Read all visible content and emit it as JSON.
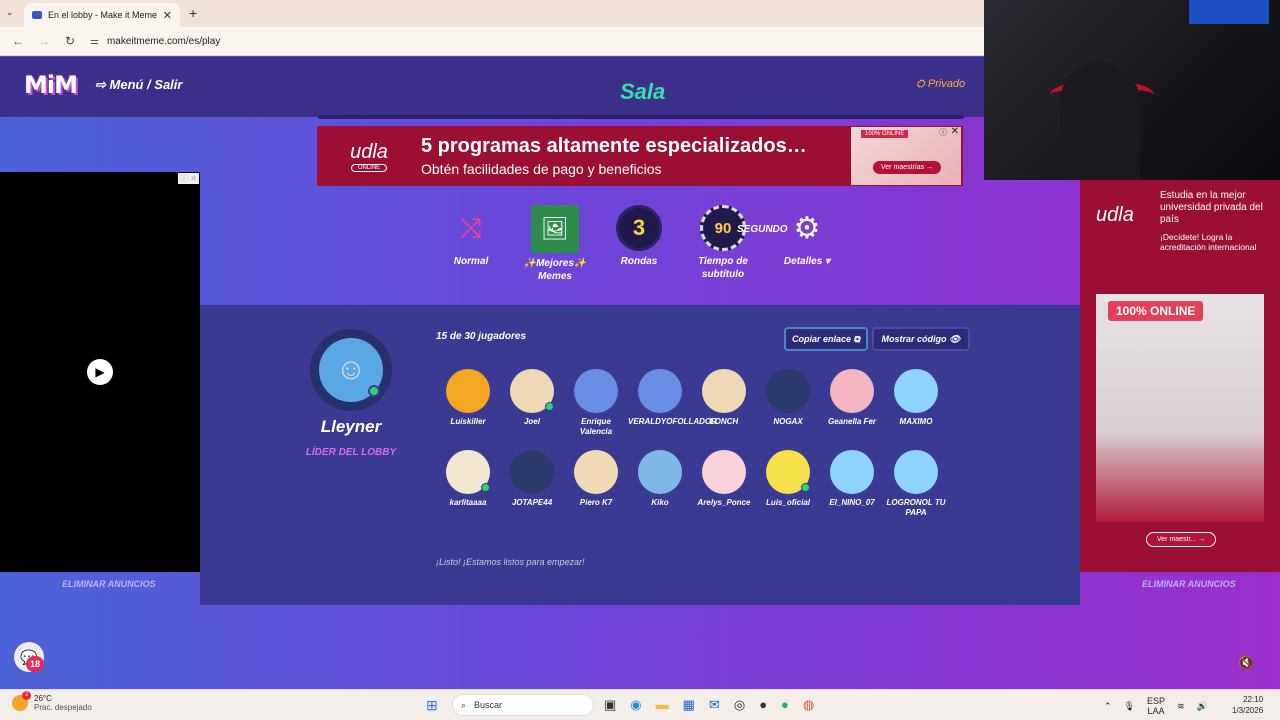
{
  "browser": {
    "tab_title": "En el lobby - Make it Meme",
    "url": "makeitmeme.com/es/play",
    "new_tab": "+",
    "close_tab": "✕",
    "tab_menu": "⌄"
  },
  "header": {
    "logo": "MiM",
    "menu_exit": "⇨ Menú / Salir",
    "room_title": "Sala",
    "privacy": "⛭ Privado"
  },
  "top_ad": {
    "logo": "udla",
    "logo_small": "ONLINE",
    "headline": "5 programas altamente especializados…",
    "sub": "Obtén facilidades de pago y beneficios",
    "badge": "100% ONLINE",
    "cta": "Ver maestrías →",
    "close": "✕",
    "info": "ⓘ"
  },
  "settings": [
    {
      "label": "Normal",
      "icon": "⤨"
    },
    {
      "label": "✨Mejores✨ Memes",
      "icon": "🖼"
    },
    {
      "label": "Rondas",
      "icon": "3"
    },
    {
      "label": "Tiempo de subtítulo",
      "icon": "90"
    },
    {
      "label": "Detalles ▾",
      "icon": "⚙"
    }
  ],
  "time_unit": "SEGUNDO",
  "lobby": {
    "host_name": "Lleyner",
    "host_role": "LÍDER DEL LOBBY",
    "players_count": "15 de 30 jugadores",
    "copy_link": "Copiar enlace ⧉",
    "show_code": "Mostrar código 👁",
    "ready_text": "¡Listo! ¡Estamos listos para empezar!",
    "players": [
      {
        "name": "Luiskiller",
        "color": "#f5a623",
        "online": false
      },
      {
        "name": "Joel",
        "color": "#f0d9b5",
        "online": true
      },
      {
        "name": "Enrique Valencia",
        "color": "#6a8ee6",
        "online": false
      },
      {
        "name": "VERALDYOFOLLADOR",
        "color": "#6a8ee6",
        "online": false
      },
      {
        "name": "LONCH",
        "color": "#f0d9b5",
        "online": false
      },
      {
        "name": "NOGAX",
        "color": "#2a3a6a",
        "online": false
      },
      {
        "name": "Geanella Fer",
        "color": "#f4b6c2",
        "online": false
      },
      {
        "name": "MAXIMO",
        "color": "#8fd3ff",
        "online": false
      },
      {
        "name": "karlitaaaa",
        "color": "#f3e7d0",
        "online": true
      },
      {
        "name": "JOTAPE44",
        "color": "#2a3a6a",
        "online": false
      },
      {
        "name": "Piero K7",
        "color": "#f0d9b5",
        "online": false
      },
      {
        "name": "Kiko",
        "color": "#7fb8e8",
        "online": false
      },
      {
        "name": "Arelys_Ponce",
        "color": "#f7d0d8",
        "online": false
      },
      {
        "name": "Luis_oficial",
        "color": "#f7e04a",
        "online": true
      },
      {
        "name": "El_NINO_07",
        "color": "#8fd3ff",
        "online": false
      },
      {
        "name": "LOGRONOL TU PAPA",
        "color": "#8fd3ff",
        "online": false
      }
    ]
  },
  "left_ad": {
    "marks": "ⓘ ✕",
    "play": "▶",
    "remove": "ELIMINAR ANUNCIOS"
  },
  "right_ad": {
    "logo": "udla",
    "title": "Estudia en la mejor universidad privada del país",
    "sub": "¡Decídete! Logra la acreditación internacional",
    "badge": "100% ONLINE",
    "cta": "Ver maestr... →",
    "remove": "ELIMINAR ANUNCIOS"
  },
  "chat": {
    "icon": "💬",
    "badge": "18"
  },
  "mute": "🔇",
  "taskbar": {
    "temp": "26°C",
    "weather": "Prac. despejado",
    "weather_badge": "2",
    "search": "Buscar",
    "lang": "ESP",
    "lang2": "LAA",
    "time": "22:10",
    "date": "1/3/2026"
  }
}
